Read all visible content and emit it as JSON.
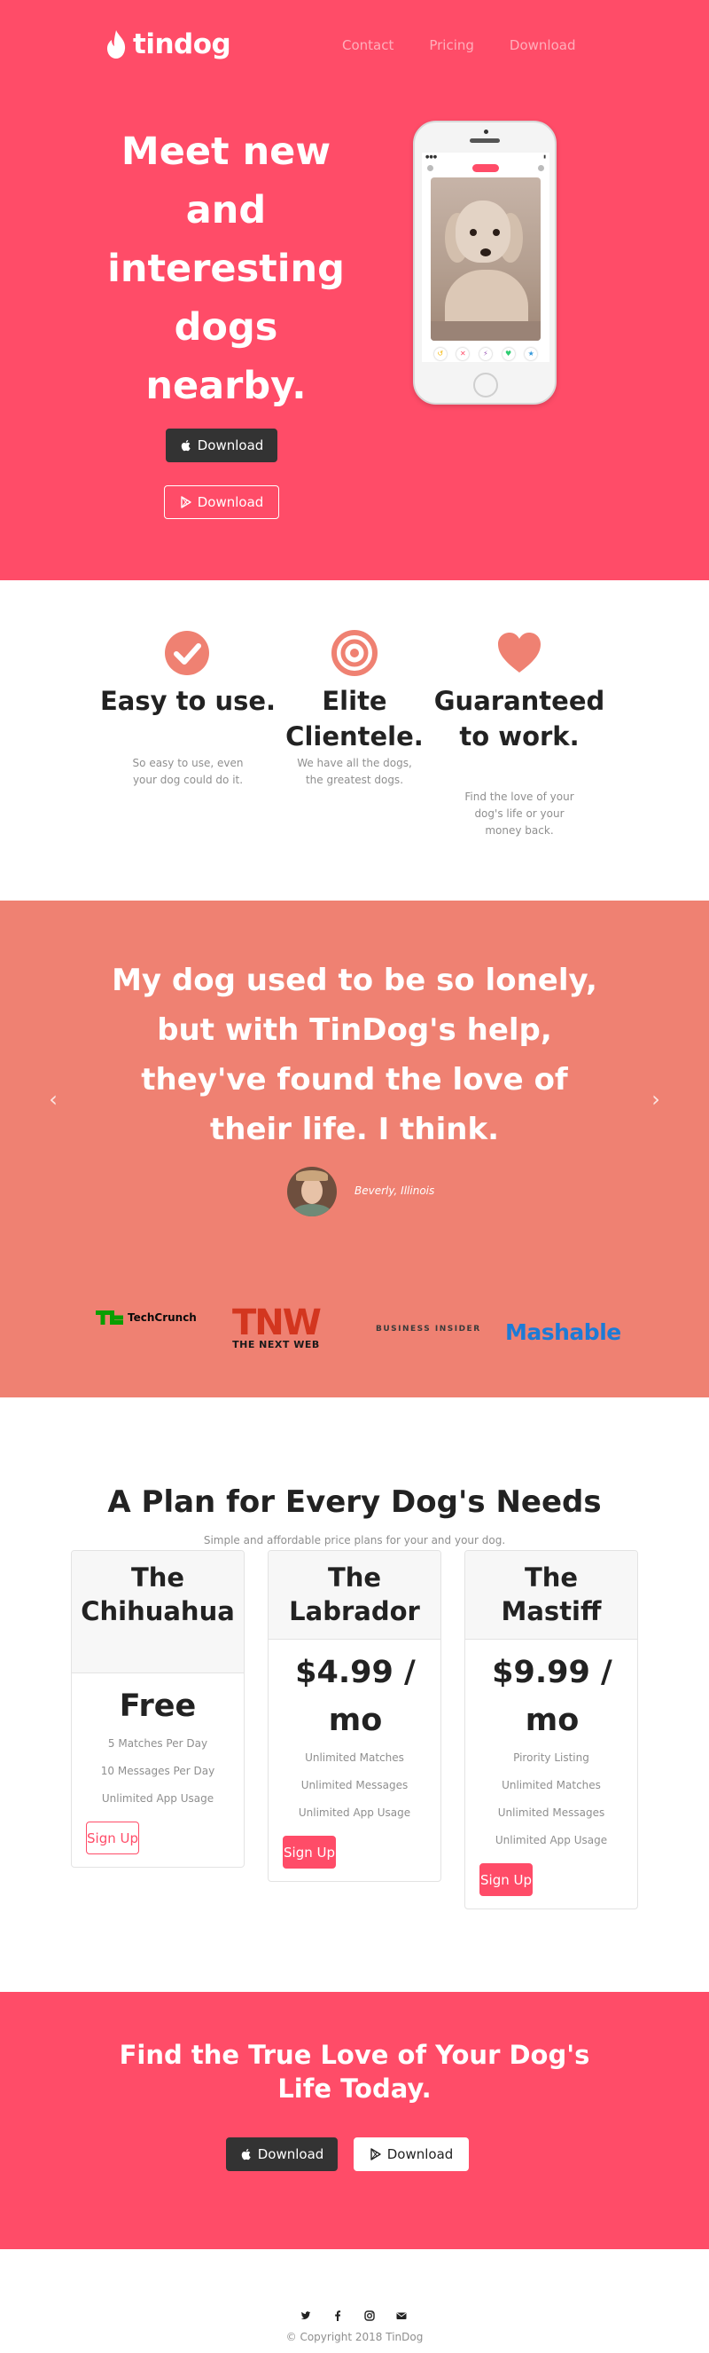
{
  "nav": {
    "brand": "tindog",
    "links": [
      "Contact",
      "Pricing",
      "Download"
    ]
  },
  "hero": {
    "title": "Meet new and interesting dogs nearby.",
    "apple_button": "Download",
    "play_button": "Download"
  },
  "features": [
    {
      "icon": "check-circle-icon",
      "title": "Easy to use.",
      "text": "So easy to use, even your dog could do it."
    },
    {
      "icon": "bullseye-icon",
      "title": "Elite Clientele.",
      "text": "We have all the dogs, the greatest dogs."
    },
    {
      "icon": "heart-icon",
      "title": "Guaranteed to work.",
      "text": "Find the love of your dog's life or your money back."
    }
  ],
  "testimonial": {
    "quote": "My dog used to be so lonely, but with TinDog's help, they've found the love of their life. I think.",
    "author": "Beverly, Illinois"
  },
  "press": {
    "techcrunch": "TechCrunch",
    "tnw_big": "TNW",
    "tnw_small": "THE NEXT WEB",
    "business_insider": "BUSINESS INSIDER",
    "mashable": "Mashable"
  },
  "pricing": {
    "title": "A Plan for Every Dog's Needs",
    "subtitle": "Simple and affordable price plans for your and your dog.",
    "plans": [
      {
        "name": "The Chihuahua",
        "price": "Free",
        "features": [
          "5 Matches Per Day",
          "10 Messages Per Day",
          "Unlimited App Usage"
        ],
        "button": "Sign Up"
      },
      {
        "name": "The Labrador",
        "price": "$4.99 / mo",
        "features": [
          "Unlimited Matches",
          "Unlimited Messages",
          "Unlimited App Usage"
        ],
        "button": "Sign Up"
      },
      {
        "name": "The Mastiff",
        "price": "$9.99 / mo",
        "features": [
          "Pirority Listing",
          "Unlimited Matches",
          "Unlimited Messages",
          "Unlimited App Usage"
        ],
        "button": "Sign Up"
      }
    ]
  },
  "cta": {
    "title": "Find the True Love of Your Dog's Life Today.",
    "apple_button": "Download",
    "play_button": "Download"
  },
  "footer": {
    "social": [
      "twitter-icon",
      "facebook-icon",
      "instagram-icon",
      "envelope-icon"
    ],
    "copyright": "© Copyright 2018 TinDog"
  },
  "colors": {
    "brand_red": "#ff4c68",
    "testimonial_bg": "#ef8172",
    "dark_button": "#333333"
  }
}
